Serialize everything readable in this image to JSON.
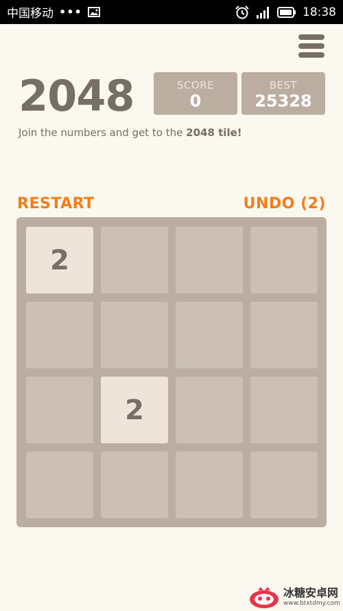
{
  "status_bar": {
    "carrier": "中国移动",
    "dots": "•••",
    "time": "18:38",
    "icons": [
      "image-icon",
      "alarm-icon",
      "signal-icon",
      "battery-icon"
    ]
  },
  "header": {
    "title": "2048",
    "menu_icon": "hamburger-menu-icon",
    "score": {
      "label": "SCORE",
      "value": "0"
    },
    "best": {
      "label": "BEST",
      "value": "25328"
    }
  },
  "intro": {
    "text": "Join the numbers and get to the ",
    "bold": "2048 tile!"
  },
  "actions": {
    "restart": "RESTART",
    "undo": "UNDO (2)"
  },
  "board": {
    "size": 4,
    "tiles": [
      [
        "2",
        "",
        "",
        ""
      ],
      [
        "",
        "",
        "",
        ""
      ],
      [
        "",
        "2",
        "",
        ""
      ],
      [
        "",
        "",
        "",
        ""
      ]
    ]
  },
  "watermark": {
    "name": "冰糖安卓网",
    "url": "www.btxtdmy.com"
  },
  "colors": {
    "background": "#faf8ef",
    "board": "#bbada0",
    "empty_cell": "#cdc1b4",
    "tile_2": "#eee4da",
    "text_dark": "#776e65",
    "accent_orange": "#f67c16"
  }
}
